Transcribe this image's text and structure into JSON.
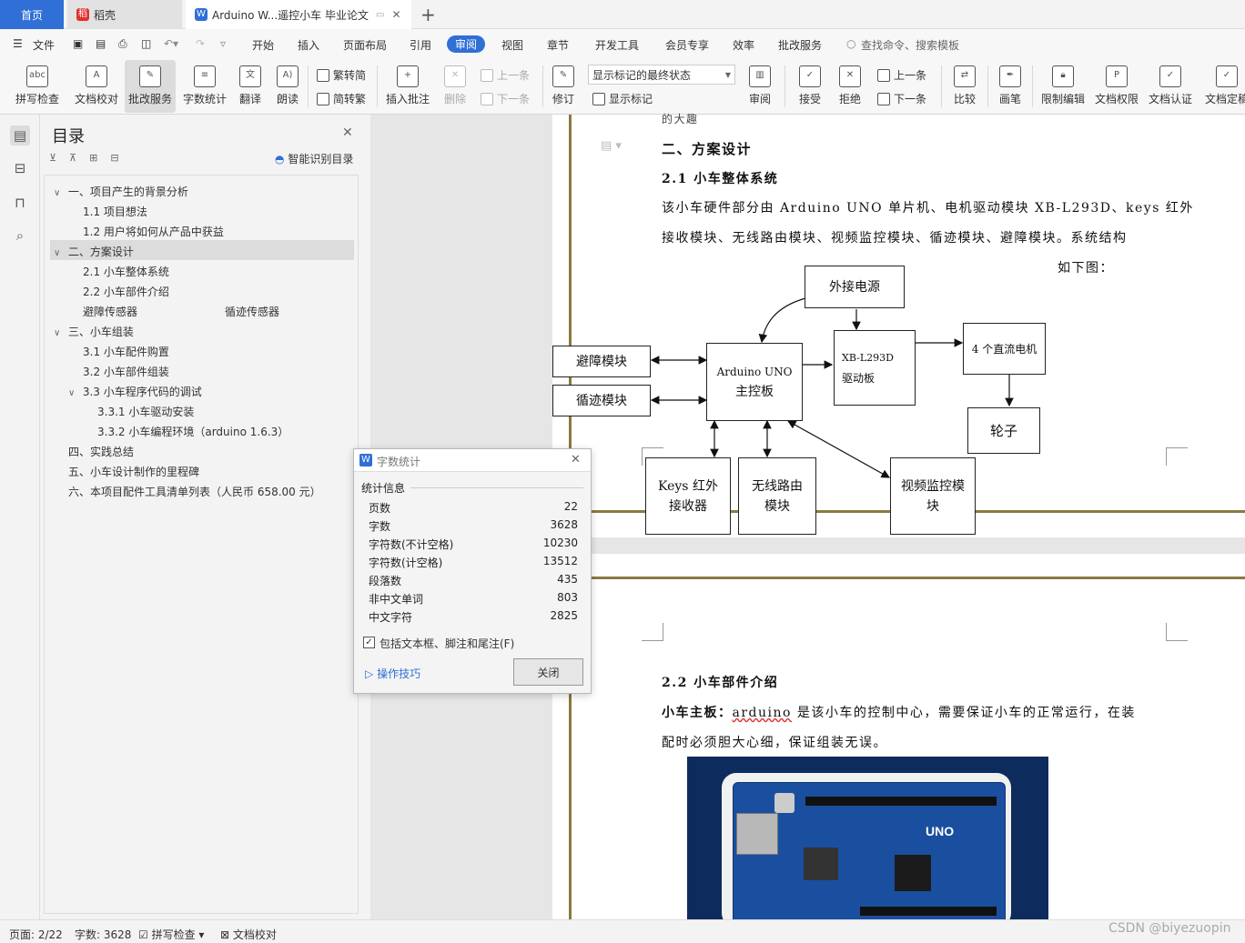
{
  "tabs": {
    "home": "首页",
    "daoke": "稻壳",
    "doc": "Arduino W...遥控小车 毕业论文"
  },
  "menu": {
    "file": "文件",
    "items": [
      "开始",
      "插入",
      "页面布局",
      "引用",
      "审阅",
      "视图",
      "章节",
      "开发工具",
      "会员专享",
      "效率",
      "批改服务"
    ],
    "search_placeholder": "查找命令、搜索模板"
  },
  "ribbon": {
    "spell": "拼写检查",
    "doc_check": "文档校对",
    "correct": "批改服务",
    "wordcount": "字数统计",
    "translate": "翻译",
    "read": "朗读",
    "t2s": "繁转简",
    "s2t": "简转繁",
    "insert_comment": "插入批注",
    "delete": "删除",
    "prev_comment": "上一条",
    "next_comment": "下一条",
    "revise": "修订",
    "markup_state": "显示标记的最终状态",
    "show_markup": "显示标记",
    "review": "审阅",
    "accept": "接受",
    "reject": "拒绝",
    "prev": "上一条",
    "next": "下一条",
    "compare": "比较",
    "pen": "画笔",
    "restrict": "限制编辑",
    "doc_perm": "文档权限",
    "doc_cert": "文档认证",
    "doc_final": "文档定稿"
  },
  "toc": {
    "title": "目录",
    "smart": "智能识别目录",
    "items": [
      "一、项目产生的背景分析",
      "1.1 项目想法",
      "1.2 用户将如何从产品中获益",
      "二、方案设计",
      "2.1 小车整体系统",
      "2.2 小车部件介绍",
      "避障传感器",
      "循迹传感器",
      "三、小车组装",
      "3.1 小车配件购置",
      "3.2 小车部件组装",
      "3.3 小车程序代码的调试",
      "3.3.1 小车驱动安装",
      "3.3.2 小车编程环境（arduino 1.6.3）",
      "四、实践总结",
      "五、小车设计制作的里程碑",
      "六、本项目配件工具清单列表（人民币 658.00 元）"
    ]
  },
  "doc": {
    "cut": "的大趣",
    "h2": "二、方案设计",
    "h21": "2.1 小车整体系统",
    "p1": "该小车硬件部分由 Arduino UNO 单片机、电机驱动模块 XB-L293D、keys 红外",
    "p2": "接收模块、无线路由模块、视频监控模块、循迹模块、避障模块。系统结构",
    "p3": "如下图：",
    "h22": "2.2 小车部件介绍",
    "p4_bold": "小车主板：",
    "p4_link": "arduino",
    "p4": " 是该小车的控制中心，需要保证小车的正常运行，在装",
    "p5": "配时必须胆大心细，保证组装无误。"
  },
  "diagram": {
    "power": "外接电源",
    "avoid": "避障模块",
    "track": "循迹模块",
    "arduino1": "Arduino UNO",
    "arduino2": "主控板",
    "driver1": "XB-L293D",
    "driver2": "驱动板",
    "motor": "4 个直流电机",
    "wheel": "轮子",
    "keys1": "Keys 红外",
    "keys2": "接收器",
    "wifi1": "无线路由",
    "wifi2": "模块",
    "video1": "视频监控模",
    "video2": "块"
  },
  "dialog": {
    "title": "字数统计",
    "section": "统计信息",
    "rows": [
      {
        "k": "页数",
        "v": "22"
      },
      {
        "k": "字数",
        "v": "3628"
      },
      {
        "k": "字符数(不计空格)",
        "v": "10230"
      },
      {
        "k": "字符数(计空格)",
        "v": "13512"
      },
      {
        "k": "段落数",
        "v": "435"
      },
      {
        "k": "非中文单词",
        "v": "803"
      },
      {
        "k": "中文字符",
        "v": "2825"
      }
    ],
    "checkbox": "包括文本框、脚注和尾注(F)",
    "tips": "操作技巧",
    "close": "关闭"
  },
  "status": {
    "page": "页面: 2/22",
    "words": "字数: 3628",
    "spell": "拼写检查",
    "doccheck": "文档校对",
    "watermark": "CSDN @biyezuopin"
  },
  "board_label": "UNO"
}
